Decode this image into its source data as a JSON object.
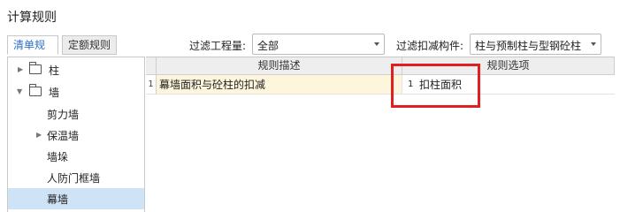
{
  "window": {
    "title": "计算规则"
  },
  "tabs": [
    {
      "label": "清单规则",
      "active": true
    },
    {
      "label": "定额规则",
      "active": false
    }
  ],
  "filters": {
    "quantity_label": "过滤工程量:",
    "quantity_value": "全部",
    "component_label": "过滤扣减构件:",
    "component_value": "柱与预制柱与型钢砼柱"
  },
  "tree": {
    "items": [
      {
        "label": "柱",
        "expanded": false
      },
      {
        "label": "墙",
        "expanded": true
      },
      {
        "label": "剪力墙"
      },
      {
        "label": "保温墙",
        "expanded": false
      },
      {
        "label": "墙垛"
      },
      {
        "label": "人防门框墙"
      },
      {
        "label": "幕墙",
        "selected": true
      }
    ]
  },
  "grid": {
    "columns": [
      "规则描述",
      "规则选项"
    ],
    "rows": [
      {
        "index": "1",
        "description": "幕墙面积与砼柱的扣减",
        "option_index": "1",
        "option": "扣柱面积"
      }
    ]
  },
  "colors": {
    "accent": "#2a6fc9",
    "selection": "#cfe3f6",
    "row_highlight": "#fdf6dc",
    "annotation": "#e02020"
  }
}
